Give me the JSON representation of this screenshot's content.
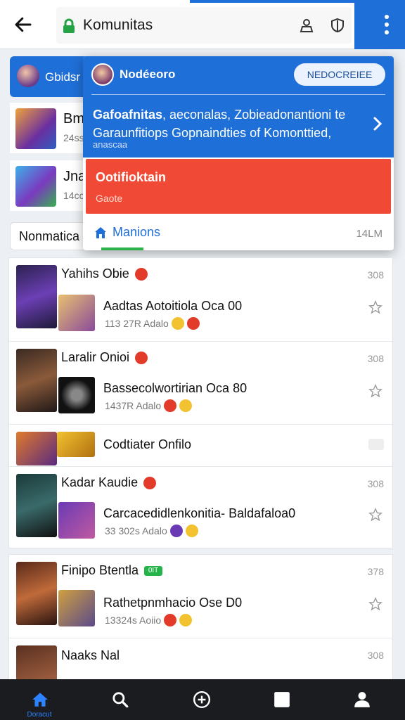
{
  "address_bar": {
    "url_text": "Komunitas",
    "icons": [
      "back-arrow-icon",
      "lock-icon",
      "account-icon",
      "shield-icon",
      "more-vert-icon"
    ]
  },
  "background": {
    "chip_label": "Gbidsr",
    "cards": [
      {
        "title": "Bm",
        "sub": "24ss"
      },
      {
        "title": "Jna",
        "sub": "14cc"
      }
    ],
    "pill_label": "Nonmatica"
  },
  "popup": {
    "user_name": "Nodéeoro",
    "badge_label": "NEDOCREIEE",
    "title_bold": "Gafoafnitas",
    "title_rest": ", aeconalas, Zobieadonantioni te Garaunfitiops Gopnaindties of Komonttied,",
    "subtitle": "anascaa",
    "alert_title": "Ootifioktain",
    "alert_sub": "Gaote",
    "tab_label": "Manions",
    "size_label": "14LM"
  },
  "feed": {
    "groups": [
      {
        "name": "Yahihs Obie",
        "badge": "red",
        "count": "308",
        "post": "Aadtas Aotoitiola Oca 00",
        "meta": "113 27R Adalo"
      },
      {
        "name": "Laralir Onioi",
        "badge": "red",
        "count": "308",
        "post": "Bassecolwortirian Oca 80",
        "meta": "1437R Adalo"
      },
      {
        "name": "Codtiater Onfilo",
        "simple": true
      },
      {
        "name": "Kadar Kaudie",
        "badge": "red",
        "count": "308",
        "post": "Carcacedidlenkonitia- Baldafaloa0",
        "meta": "33 302s Adalo"
      }
    ],
    "group2": [
      {
        "name": "Finipo Btentla",
        "badge": "green",
        "badge_text": "0IT",
        "count": "378",
        "post": "Rathetpnmhacio Ose D0",
        "meta": "13324s Aoiio"
      },
      {
        "name": "Naaks Nal",
        "count": "308"
      }
    ]
  },
  "bottom_nav": {
    "items": [
      {
        "icon": "home-icon",
        "label": "Doracut",
        "active": true
      },
      {
        "icon": "search-icon",
        "label": ""
      },
      {
        "icon": "add-circle-icon",
        "label": ""
      },
      {
        "icon": "square-icon",
        "label": ""
      },
      {
        "icon": "profile-icon",
        "label": ""
      }
    ]
  },
  "colors": {
    "primary_blue": "#1f6fd8",
    "alert_red": "#f04a36",
    "accent_green": "#2bb34a",
    "nav_bg": "#1a1c20"
  }
}
